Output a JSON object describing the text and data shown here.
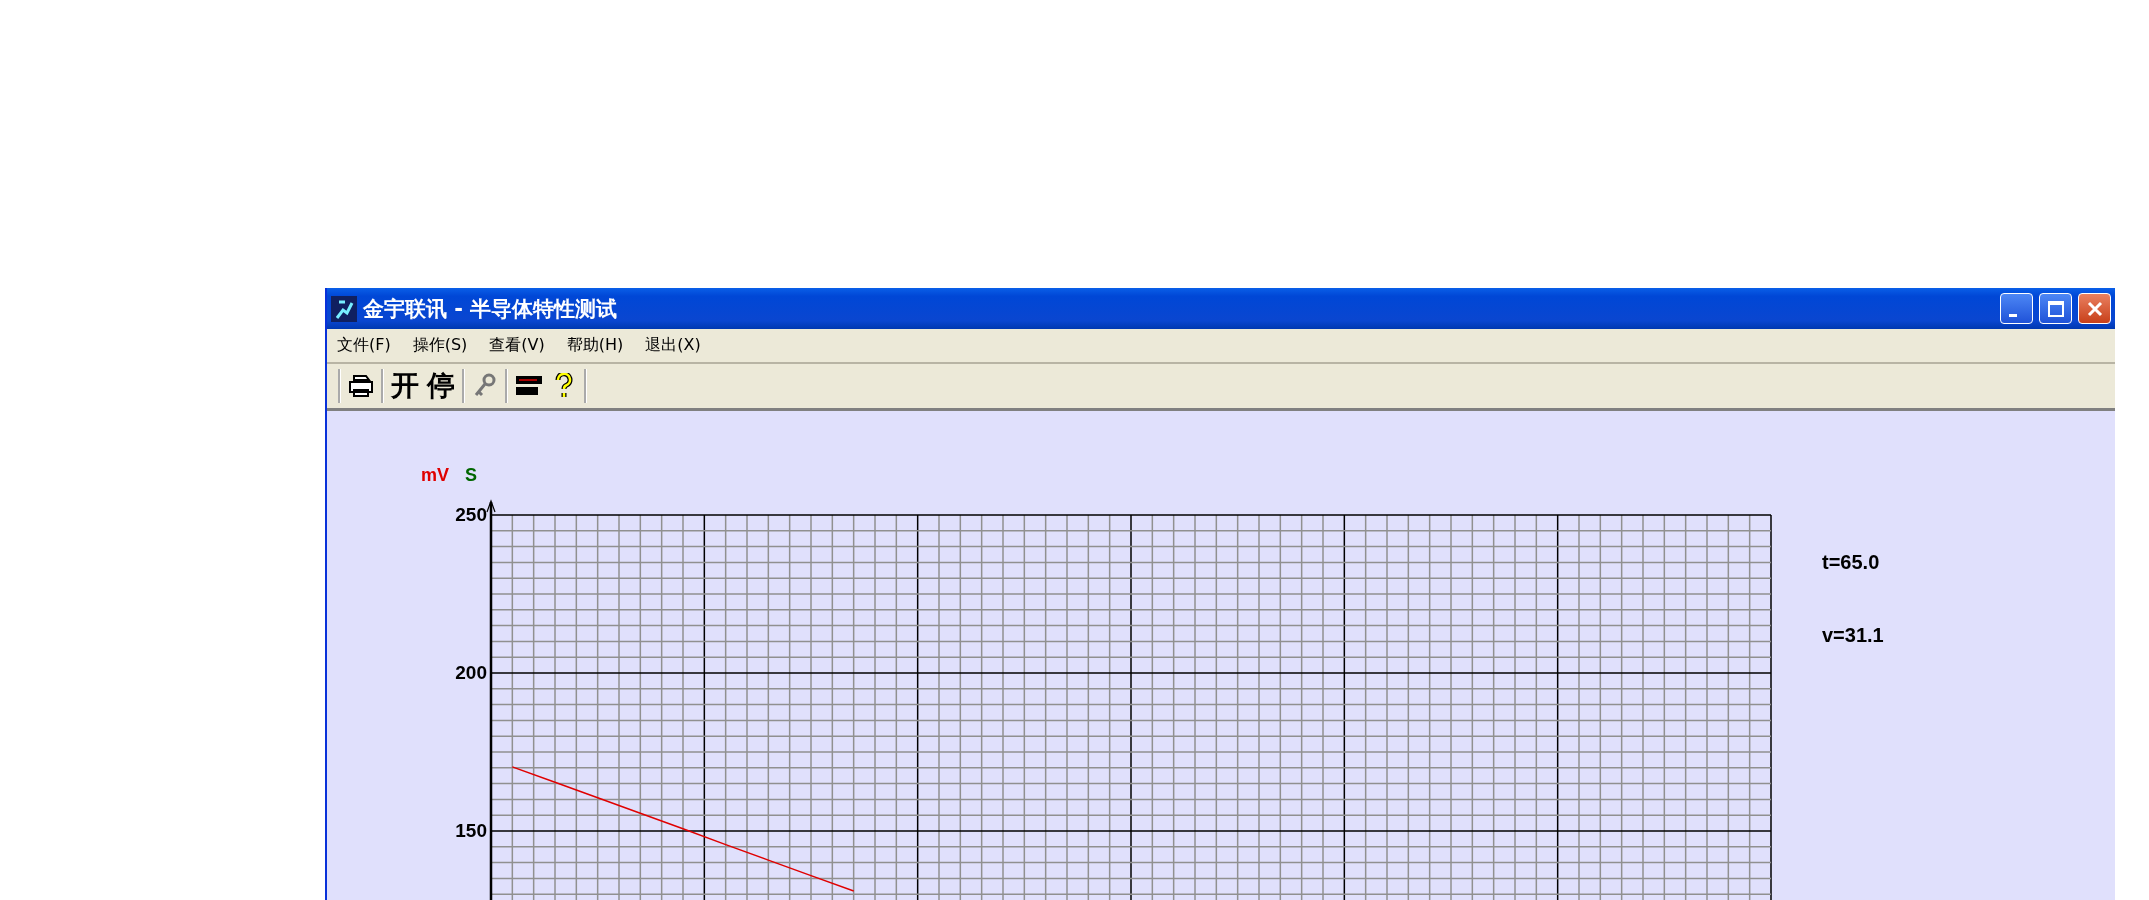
{
  "window": {
    "title": "金宇联讯 - 半导体特性测试"
  },
  "menu": [
    "文件(F)",
    "操作(S)",
    "查看(V)",
    "帮助(H)",
    "退出(X)"
  ],
  "toolbar": [
    {
      "kind": "printer"
    },
    {
      "kind": "text",
      "label": "开"
    },
    {
      "kind": "text",
      "label": "停"
    },
    {
      "kind": "key"
    },
    {
      "kind": "device"
    },
    {
      "kind": "help"
    }
  ],
  "second_unit": "S",
  "chart_data": {
    "type": "line",
    "categories": [
      null,
      null,
      null,
      null,
      null,
      null,
      null,
      null,
      null,
      null,
      null,
      null,
      null,
      null,
      null,
      null,
      null,
      null,
      null,
      null,
      null,
      null,
      null,
      null,
      null,
      null,
      null,
      null,
      null,
      null
    ],
    "grid": true,
    "ylim": [
      100,
      250
    ],
    "yticks": [
      {
        "value": 150,
        "label": "150"
      },
      {
        "value": 200,
        "label": "200"
      },
      {
        "value": 250,
        "label": "250"
      }
    ],
    "series": [
      {
        "name": "mV",
        "color": "#e00000",
        "values": [
          170.3,
          165.4,
          160.5,
          155.6,
          150.7,
          145.7,
          140.8,
          135.9,
          131.0,
          null,
          null,
          null,
          null,
          null,
          null,
          null,
          null,
          null,
          null,
          null,
          null,
          null,
          null,
          null,
          null,
          null,
          null,
          null,
          null,
          null
        ]
      }
    ]
  },
  "readouts": [
    "t=65.0",
    "v=31.1"
  ]
}
